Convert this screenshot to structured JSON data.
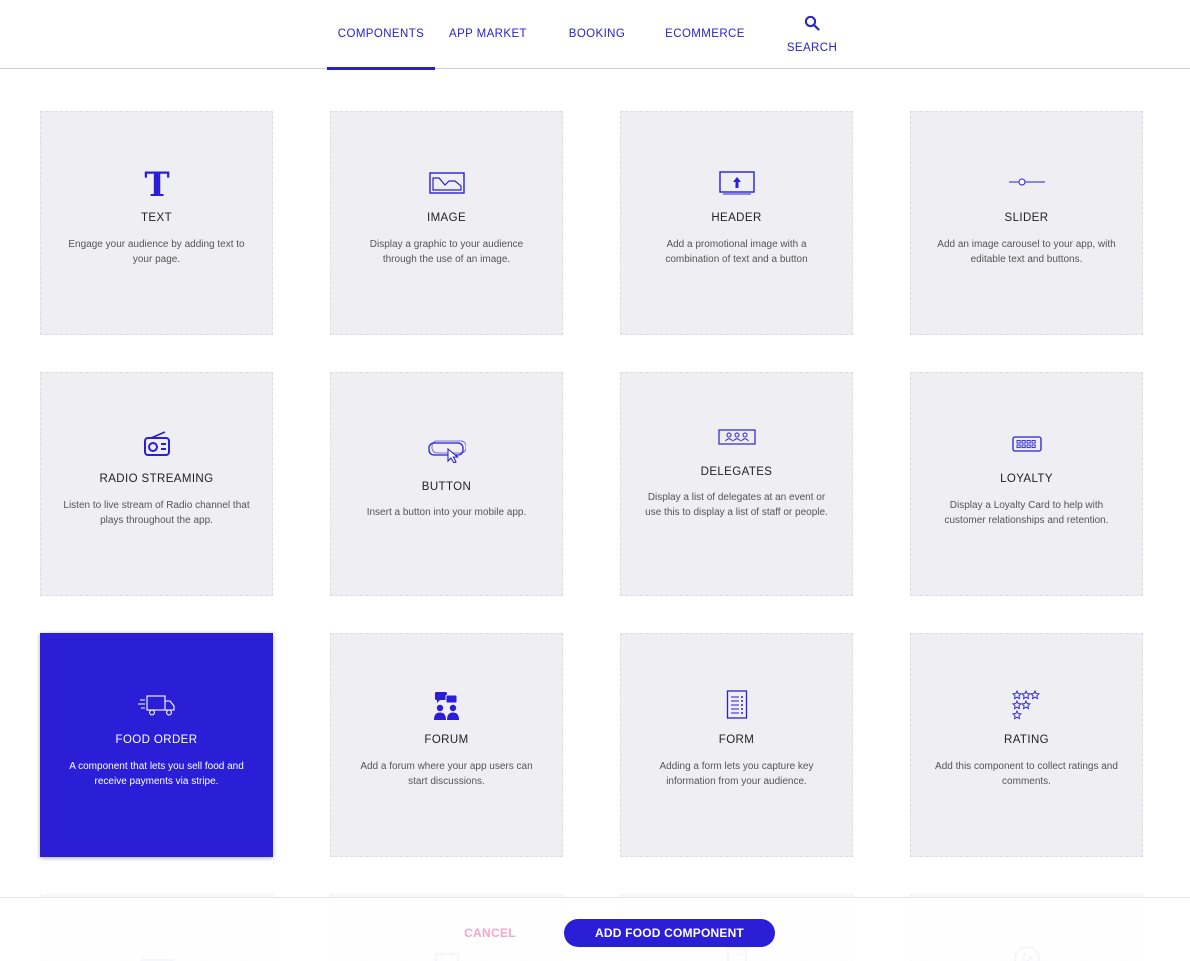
{
  "nav": {
    "tabs": [
      {
        "label": "COMPONENTS"
      },
      {
        "label": "APP MARKET"
      },
      {
        "label": "BOOKING"
      },
      {
        "label": "ECOMMERCE"
      },
      {
        "label": "SEARCH",
        "icon": "search-icon"
      }
    ],
    "active": "COMPONENTS"
  },
  "components": [
    {
      "title": "TEXT",
      "desc": "Engage your audience by adding text to your page.",
      "icon": "text-icon"
    },
    {
      "title": "IMAGE",
      "desc": "Display a graphic to your audience through the use of an image.",
      "icon": "image-icon"
    },
    {
      "title": "HEADER",
      "desc": "Add a promotional image with a combination of text and a button",
      "icon": "header-icon"
    },
    {
      "title": "SLIDER",
      "desc": "Add an image carousel to your app, with editable text and buttons.",
      "icon": "slider-icon"
    },
    {
      "title": "RADIO STREAMING",
      "desc": "Listen to live stream of Radio channel that plays throughout the app.",
      "icon": "radio-icon"
    },
    {
      "title": "BUTTON",
      "desc": "Insert a button into your mobile app.",
      "icon": "button-icon"
    },
    {
      "title": "DELEGATES",
      "desc": "Display a list of delegates at an event or use this to display a list of staff or people.",
      "icon": "delegates-icon"
    },
    {
      "title": "LOYALTY",
      "desc": "Display a Loyalty Card to help with customer relationships and retention.",
      "icon": "loyalty-card-icon"
    },
    {
      "title": "FOOD ORDER",
      "desc": "A component that lets you sell food and receive payments via stripe.",
      "icon": "delivery-truck-icon",
      "selected": true
    },
    {
      "title": "FORUM",
      "desc": "Add a forum where your app users can start discussions.",
      "icon": "forum-icon"
    },
    {
      "title": "FORM",
      "desc": "Adding a form lets you capture key information from your audience.",
      "icon": "form-icon"
    },
    {
      "title": "RATING",
      "desc": "Add this component to collect ratings and comments.",
      "icon": "rating-stars-icon"
    }
  ],
  "colors": {
    "accent": "#2a1fd6",
    "card_bg": "#efeff3",
    "cancel": "#f4a6cf"
  },
  "footer": {
    "cancel_label": "CANCEL",
    "add_label": "ADD FOOD COMPONENT"
  }
}
